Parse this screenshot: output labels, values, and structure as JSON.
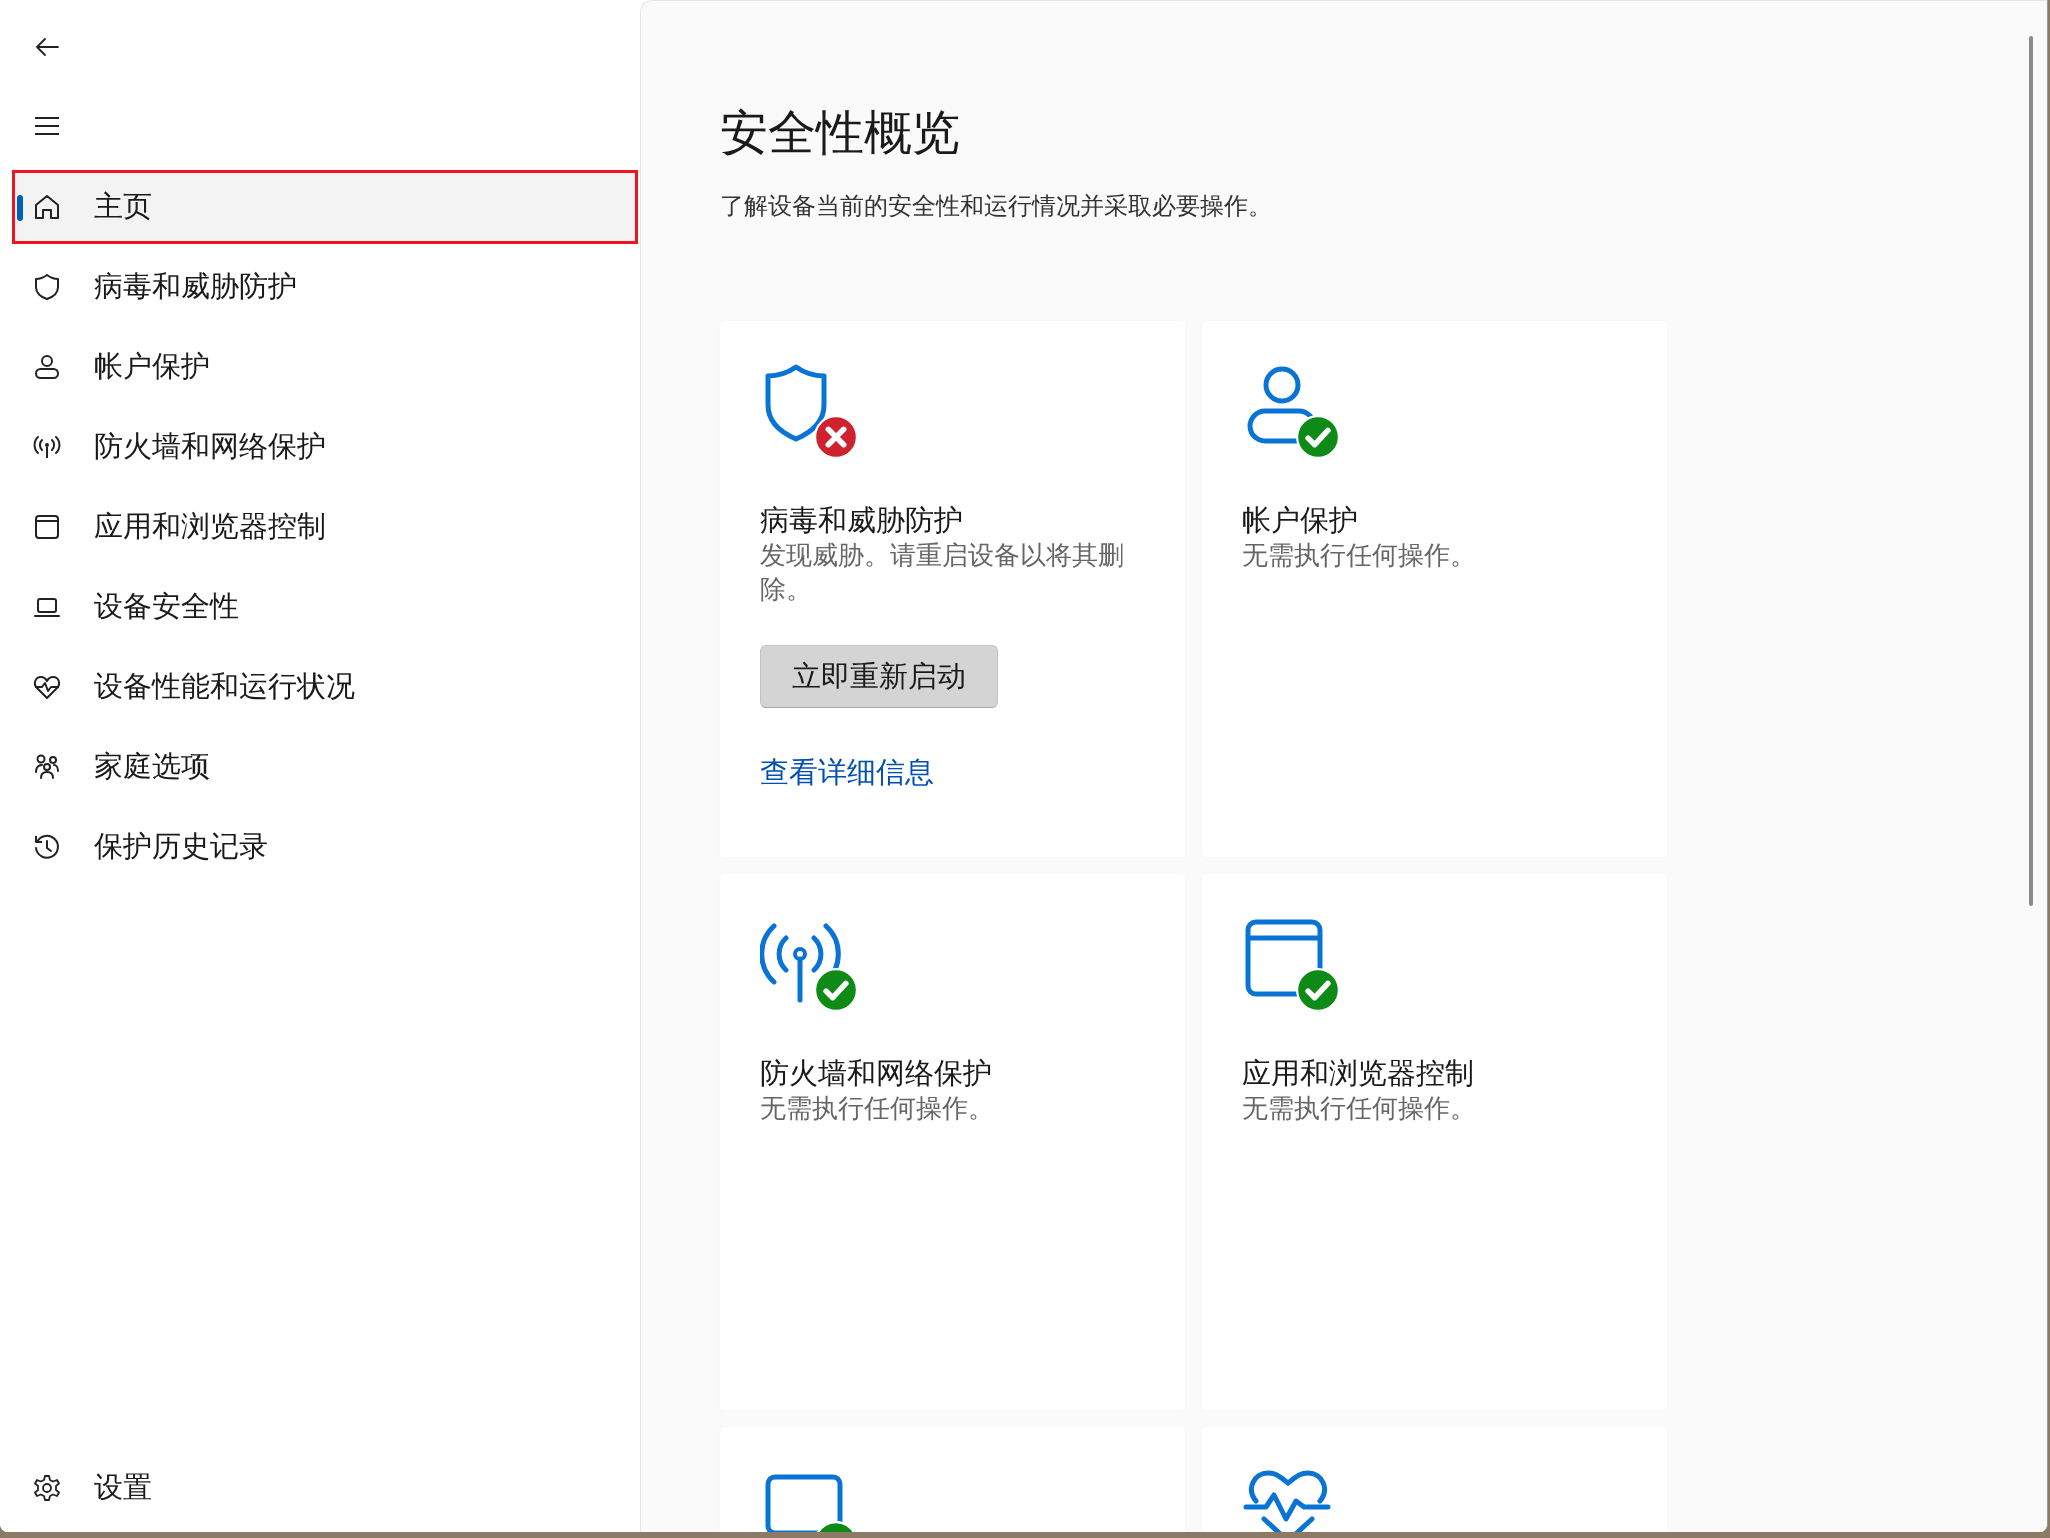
{
  "sidebar": {
    "items": [
      {
        "kind": "home",
        "label": "主页",
        "selected": true,
        "highlighted": true
      },
      {
        "kind": "shield",
        "label": "病毒和威胁防护",
        "selected": false,
        "highlighted": false
      },
      {
        "kind": "person",
        "label": "帐户保护",
        "selected": false,
        "highlighted": false
      },
      {
        "kind": "antenna",
        "label": "防火墙和网络保护",
        "selected": false,
        "highlighted": false
      },
      {
        "kind": "window",
        "label": "应用和浏览器控制",
        "selected": false,
        "highlighted": false
      },
      {
        "kind": "laptop",
        "label": "设备安全性",
        "selected": false,
        "highlighted": false
      },
      {
        "kind": "heart",
        "label": "设备性能和运行状况",
        "selected": false,
        "highlighted": false
      },
      {
        "kind": "family",
        "label": "家庭选项",
        "selected": false,
        "highlighted": false
      },
      {
        "kind": "history",
        "label": "保护历史记录",
        "selected": false,
        "highlighted": false
      }
    ],
    "settings": {
      "label": "设置"
    }
  },
  "page": {
    "title": "安全性概览",
    "subtitle": "了解设备当前的安全性和运行情况并采取必要操作。"
  },
  "cards": [
    {
      "kind": "shield",
      "healthy": false,
      "title": "病毒和威胁防护",
      "description": "发现威胁。请重启设备以将其删除。",
      "button": "立即重新启动",
      "link": "查看详细信息"
    },
    {
      "kind": "person",
      "healthy": true,
      "title": "帐户保护",
      "description": "无需执行任何操作。"
    },
    {
      "kind": "antenna",
      "healthy": true,
      "title": "防火墙和网络保护",
      "description": "无需执行任何操作。"
    },
    {
      "kind": "window",
      "healthy": true,
      "title": "应用和浏览器控制",
      "description": "无需执行任何操作。"
    },
    {
      "kind": "laptop",
      "healthy": true
    },
    {
      "kind": "heart"
    }
  ]
}
